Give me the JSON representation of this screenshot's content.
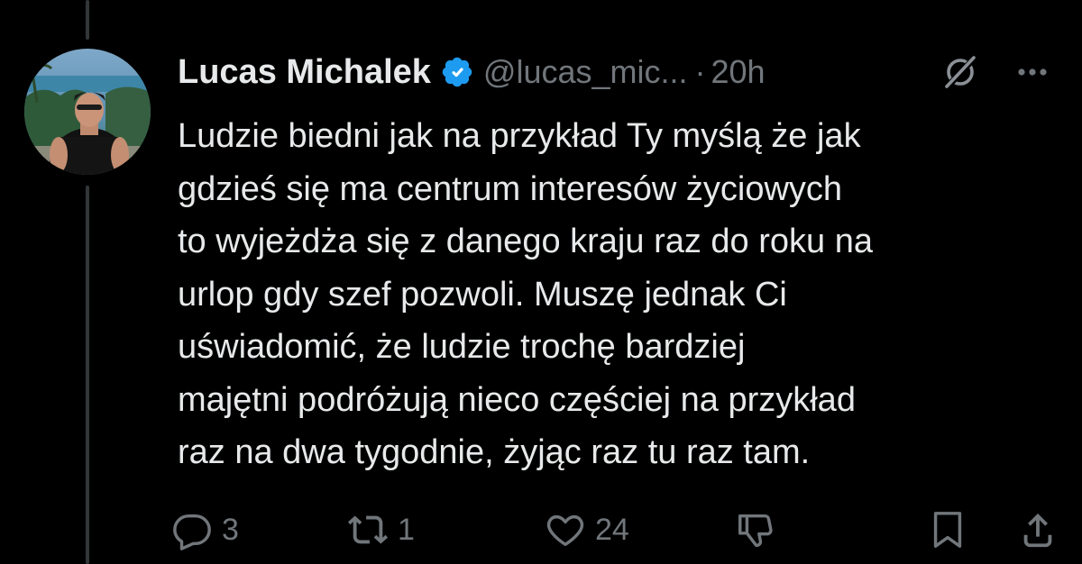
{
  "tweet": {
    "display_name": "Lucas Michalek",
    "handle": "@lucas_mic...",
    "separator": "·",
    "time": "20h",
    "text": "Ludzie biedni jak na przykład Ty myślą że jak\ngdzieś się ma centrum interesów życiowych\nto wyjeżdża się z danego kraju raz do roku na\nurlop gdy szef pozwoli. Muszę jednak Ci\nuświadomić, że ludzie trochę bardziej\nmajętni podróżują nieco częściej na przykład\nraz na dwa tygodnie, żyjąc raz tu raz tam."
  },
  "actions": {
    "reply_count": "3",
    "retweet_count": "1",
    "like_count": "24"
  },
  "icons": {
    "verified": "verified-badge-icon",
    "grok": "grok-icon",
    "more": "more-icon",
    "reply": "reply-icon",
    "retweet": "retweet-icon",
    "like": "heart-icon",
    "dislike": "downvote-icon",
    "bookmark": "bookmark-icon",
    "share": "share-icon"
  },
  "colors": {
    "background": "#000000",
    "text_primary": "#e7e9ea",
    "text_secondary": "#71767b",
    "verified_blue": "#1d9bf0",
    "thread_line": "#333639"
  }
}
